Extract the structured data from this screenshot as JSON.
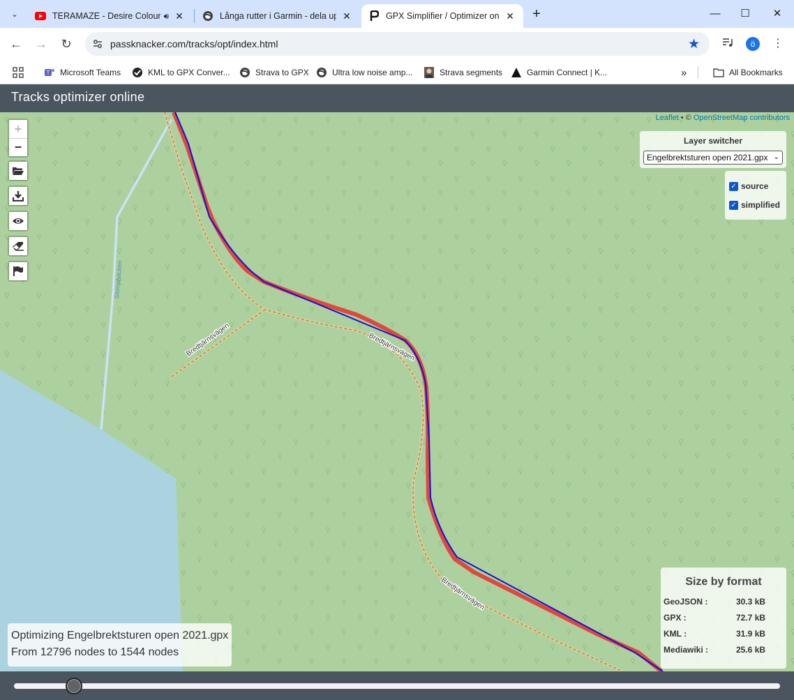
{
  "browser": {
    "tabs": [
      {
        "title": "TERAMAZE - Desire Colours",
        "icon": "youtube-icon",
        "audio": true
      },
      {
        "title": "Långa rutter i Garmin - dela upp",
        "icon": "globe-icon"
      },
      {
        "title": "GPX Simplifier / Optimizer online",
        "icon": "passknacker-icon",
        "active": true
      }
    ],
    "url": "passknacker.com/tracks/opt/index.html",
    "profile_initial": "ö",
    "bookmarks": [
      {
        "label": "Microsoft Teams",
        "icon": "teams-icon"
      },
      {
        "label": "KML to GPX Conver...",
        "icon": "check-icon"
      },
      {
        "label": "Strava to GPX",
        "icon": "globe-icon"
      },
      {
        "label": "Ultra low noise amp...",
        "icon": "globe-icon"
      },
      {
        "label": "Strava segments",
        "icon": "avatar-icon"
      },
      {
        "label": "Garmin Connect | K...",
        "icon": "garmin-icon"
      }
    ],
    "all_bookmarks": "All Bookmarks",
    "overflow": "»"
  },
  "page": {
    "title": "Tracks optimizer online"
  },
  "map": {
    "attribution_leaflet": "Leaflet",
    "attribution_sep": " • © ",
    "attribution_osm": "OpenStreetMap contributors",
    "road_labels": [
      "Bredtjärnsvägen",
      "Bredtjärnsvägen",
      "Bredtjärnsvägen",
      "Stompbäcken"
    ],
    "controls": {
      "zoom_in": "+",
      "zoom_out": "−",
      "tools": [
        "open-folder-icon",
        "download-icon",
        "eye-icon",
        "eraser-icon",
        "flag-icon"
      ]
    },
    "layer_switcher": {
      "title": "Layer switcher",
      "selected": "Engelbrektsturen open 2021.gpx",
      "layers": [
        {
          "label": "source",
          "checked": true
        },
        {
          "label": "simplified",
          "checked": true
        }
      ]
    },
    "size_by_format": {
      "title": "Size by format",
      "rows": [
        {
          "format": "GeoJSON :",
          "size": "30.3 kB"
        },
        {
          "format": "GPX :",
          "size": "72.7 kB"
        },
        {
          "format": "KML :",
          "size": "31.9 kB"
        },
        {
          "format": "Mediawiki :",
          "size": "25.6 kB"
        }
      ]
    },
    "info": {
      "line1": "Optimizing Engelbrektsturen open 2021.gpx",
      "line2": "From 12796 nodes to 1544 nodes"
    },
    "colors": {
      "forest": "#add19e",
      "water": "#aad3df",
      "source_track": "#e0483a",
      "simplified_track": "#1010e0"
    }
  },
  "slider": {
    "value_fraction": 0.078
  }
}
